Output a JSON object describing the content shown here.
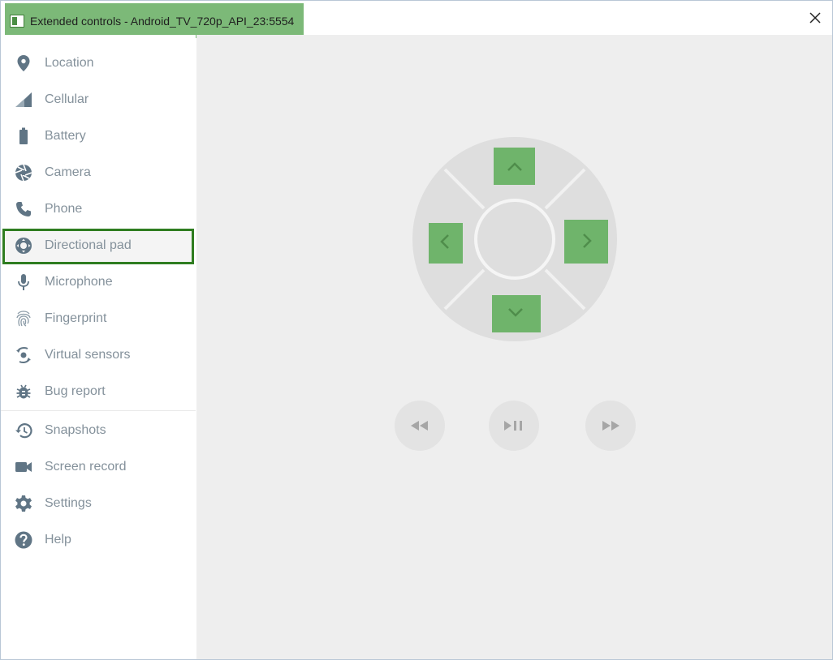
{
  "window": {
    "title": "Extended controls - Android_TV_720p_API_23:5554"
  },
  "sidebar": {
    "items": [
      {
        "label": "Location",
        "icon": "location-pin-icon"
      },
      {
        "label": "Cellular",
        "icon": "cellular-signal-icon"
      },
      {
        "label": "Battery",
        "icon": "battery-icon"
      },
      {
        "label": "Camera",
        "icon": "camera-aperture-icon"
      },
      {
        "label": "Phone",
        "icon": "phone-icon"
      },
      {
        "label": "Directional pad",
        "icon": "directional-pad-icon",
        "selected": true
      },
      {
        "label": "Microphone",
        "icon": "microphone-icon"
      },
      {
        "label": "Fingerprint",
        "icon": "fingerprint-icon"
      },
      {
        "label": "Virtual sensors",
        "icon": "virtual-sensors-icon"
      },
      {
        "label": "Bug report",
        "icon": "bug-icon"
      },
      {
        "label": "Snapshots",
        "icon": "history-icon"
      },
      {
        "label": "Screen record",
        "icon": "video-camera-icon"
      },
      {
        "label": "Settings",
        "icon": "gear-icon"
      },
      {
        "label": "Help",
        "icon": "help-icon"
      }
    ]
  },
  "dpad": {
    "buttons": [
      "up-arrow-icon",
      "left-arrow-icon",
      "right-arrow-icon",
      "down-arrow-icon"
    ],
    "center": "select-button"
  },
  "media": {
    "buttons": [
      "rewind-icon",
      "play-pause-icon",
      "fast-forward-icon"
    ]
  },
  "colors": {
    "title_highlight": "#7cb978",
    "selected_border": "#2f7d20",
    "dpad_button": "#6fb46b",
    "dpad_disc": "#dedede",
    "sidebar_text": "#84919b",
    "icon_color": "#607585"
  }
}
